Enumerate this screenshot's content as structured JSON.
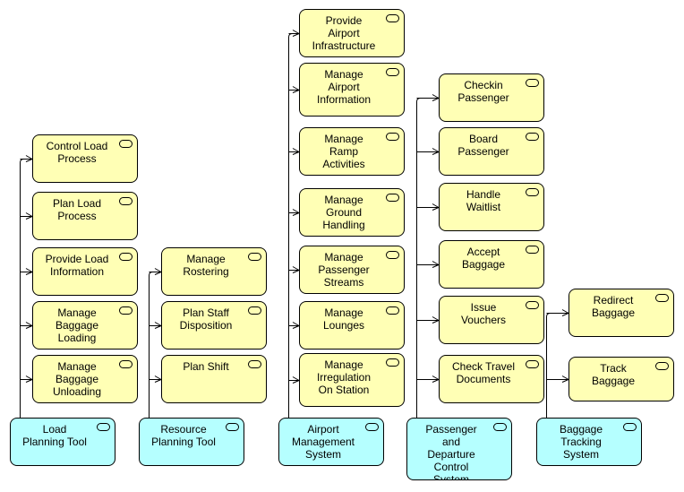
{
  "colors": {
    "function_fill": "#ffffb5",
    "system_fill": "#b5ffff",
    "line": "#000000"
  },
  "icons": {
    "function": "archimate-rounded-rect-icon",
    "system": "archimate-rounded-rect-icon",
    "connector": "open-arrow-icon"
  },
  "columns": [
    {
      "system": "Load\nPlanning Tool",
      "functions": [
        "Control Load\nProcess",
        "Plan Load\nProcess",
        "Provide Load\nInformation",
        "Manage\nBaggage\nLoading",
        "Manage\nBaggage\nUnloading"
      ]
    },
    {
      "system": "Resource\nPlanning Tool",
      "functions": [
        "Manage\nRostering",
        "Plan Staff\nDisposition",
        "Plan Shift"
      ]
    },
    {
      "system": "Airport\nManagement\nSystem",
      "functions": [
        "Provide\nAirport\nInfrastructure",
        "Manage\nAirport\nInformation",
        "Manage\nRamp\nActivities",
        "Manage\nGround\nHandling",
        "Manage\nPassenger\nStreams",
        "Manage\nLounges",
        "Manage\nIrregulation\nOn Station"
      ]
    },
    {
      "system": "Passenger\nand\nDeparture\nControl\nSystem",
      "functions": [
        "Checkin\nPassenger",
        "Board\nPassenger",
        "Handle\nWaitlist",
        "Accept\nBaggage",
        "Issue\nVouchers",
        "Check Travel\nDocuments"
      ]
    },
    {
      "system": "Baggage\nTracking\nSystem",
      "functions": [
        "Redirect\nBaggage",
        "Track\nBaggage"
      ]
    }
  ]
}
